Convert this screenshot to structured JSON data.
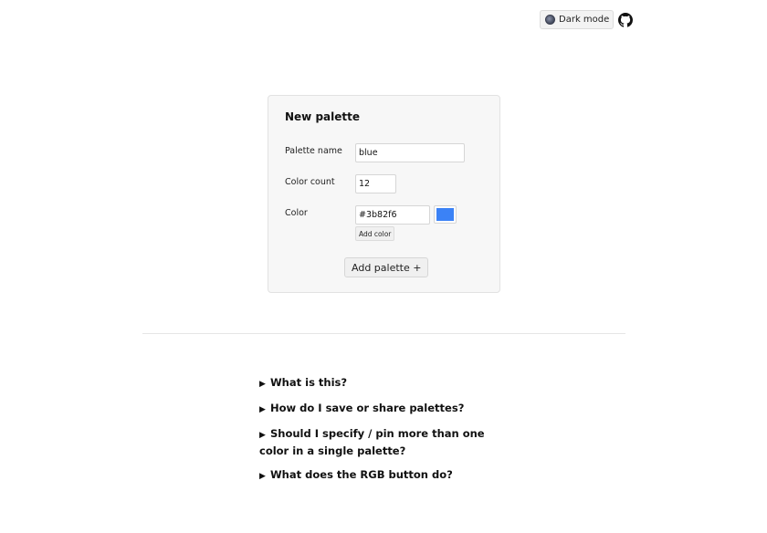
{
  "header": {
    "dark_mode_label": "Dark mode",
    "icons": [
      "moon-icon",
      "github-icon"
    ]
  },
  "form": {
    "title": "New palette",
    "palette_name_label": "Palette name",
    "palette_name_value": "blue",
    "color_count_label": "Color count",
    "color_count_value": "12",
    "color_label": "Color",
    "color_value": "#3b82f6",
    "swatch_color": "#3b82f6",
    "add_color_label": "Add color",
    "add_palette_label": "Add palette +"
  },
  "faq": {
    "items": [
      {
        "marker": "▶",
        "label": "What is this?"
      },
      {
        "marker": "▶",
        "label": "How do I save or share palettes?"
      },
      {
        "marker": "▶",
        "label": "Should I specify / pin more than one color in a single palette?"
      },
      {
        "marker": "▶",
        "label": "What does the RGB button do?"
      }
    ]
  }
}
